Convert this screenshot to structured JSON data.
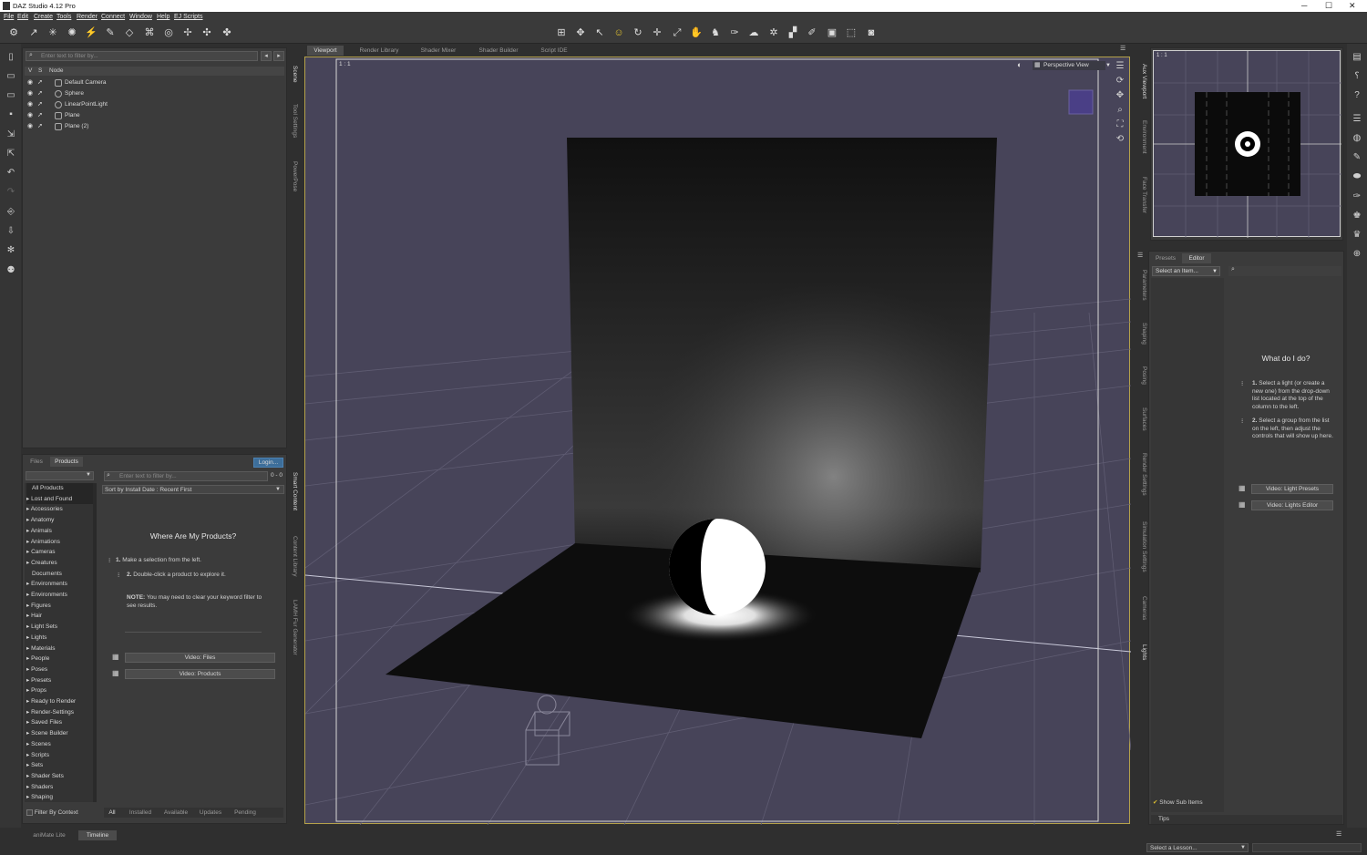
{
  "window": {
    "title": "DAZ Studio 4.12 Pro",
    "controls": [
      "─",
      "☐",
      "✕"
    ]
  },
  "menu": [
    "File",
    "Edit",
    "Create",
    "Tools",
    "Render",
    "Connect",
    "Window",
    "Help",
    "EJ Scripts"
  ],
  "scene": {
    "filter_placeholder": "Enter text to filter by...",
    "col_v": "V",
    "col_s": "S",
    "col_node": "Node",
    "nodes": [
      "Default Camera",
      "Sphere",
      "LinearPointLight",
      "Plane",
      "Plane (2)"
    ]
  },
  "left_vtabs": [
    "Scene",
    "Tool Settings",
    "PowerPose"
  ],
  "left_vtabs2": [
    "Smart Content",
    "Content Library",
    "LAMH Fur Generator"
  ],
  "content": {
    "tabs": [
      "Files",
      "Products"
    ],
    "login": "Login...",
    "filter_placeholder": "Enter text to filter by...",
    "count": "0 - 0",
    "sort": "Sort by Install Date : Recent First",
    "categories": [
      "All Products",
      "Lost and Found",
      "Accessories",
      "Anatomy",
      "Animals",
      "Animations",
      "Cameras",
      "Creatures",
      "Documents",
      "Environments",
      "Environments",
      "Figures",
      "Hair",
      "Light Sets",
      "Lights",
      "Materials",
      "People",
      "Poses",
      "Presets",
      "Props",
      "Ready to Render",
      "Render-Settings",
      "Saved Files",
      "Scene Builder",
      "Scenes",
      "Scripts",
      "Sets",
      "Shader Sets",
      "Shaders",
      "Shaping"
    ],
    "heading": "Where Are My Products?",
    "step1_num": "1.",
    "step1": "Make a selection from the left.",
    "step2_num": "2.",
    "step2": "Double-click a product to explore it.",
    "note_label": "NOTE:",
    "note": "You may need to clear your keyword filter to see results.",
    "video_files": "Video: Files",
    "video_products": "Video: Products",
    "filter_by_context": "Filter By Context",
    "bottom_tabs": [
      "All",
      "Installed",
      "Available",
      "Updates",
      "Pending"
    ]
  },
  "viewport": {
    "tabs": [
      "Viewport",
      "Render Library",
      "Shader Mixer",
      "Shader Builder",
      "Script IDE"
    ],
    "ratio": "1 : 1",
    "view": "Perspective View"
  },
  "aux": {
    "ratio": "1 : 1"
  },
  "right_vtabs": [
    "Aux Viewport",
    "Environment",
    "Face Transfer"
  ],
  "right_vtabs2": [
    "Parameters",
    "Shaping",
    "Posing",
    "Surfaces",
    "Render Settings",
    "Simulation Settings",
    "Cameras",
    "Lights"
  ],
  "lights": {
    "tabs": [
      "Presets",
      "Editor"
    ],
    "select": "Select an Item...",
    "heading": "What do I do?",
    "step1_num": "1.",
    "step1": "Select a light (or create a new one) from the drop-down list located at the top of the column to the left.",
    "step2_num": "2.",
    "step2": "Select a group from the list on the left, then adjust the controls that will show up here.",
    "video_presets": "Video: Light Presets",
    "video_editor": "Video: Lights Editor",
    "show_sub": "Show Sub Items",
    "tips": "Tips"
  },
  "bottom": {
    "tabs": [
      "aniMate Lite",
      "Timeline"
    ],
    "lesson": "Select a Lesson..."
  }
}
